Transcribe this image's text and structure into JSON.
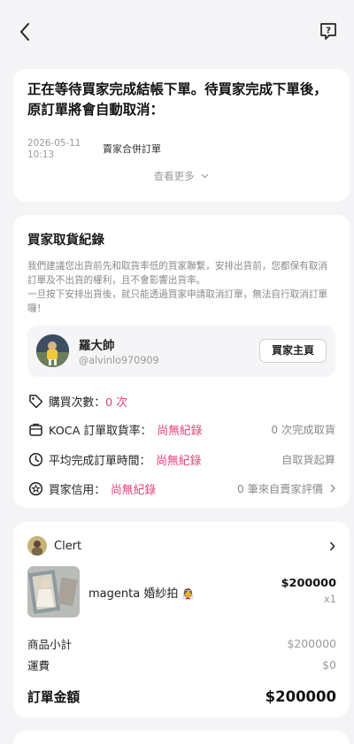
{
  "notice": {
    "text": "正在等待買家完成結帳下單。待買家完成下單後，原訂單將會自動取消："
  },
  "event": {
    "date": "2026-05-11",
    "time": "10:13",
    "label": "賣家合併訂單"
  },
  "see_more": "查看更多",
  "buyer_section": {
    "title": "買家取貨紀錄",
    "advice": "我們建議您出貨前先和取貨率低的買家聯繫，安排出貨前，您都保有取消訂單及不出貨的權利，且不會影響出貨率。\n一旦按下安排出貨後，就只能透過買家申請取消訂單，無法自行取消訂單囉！",
    "buyer_name": "羅大帥",
    "buyer_handle": "@alvinlo970909",
    "home_button": "買家主頁",
    "stats": {
      "purchases_label": "購買次數：",
      "purchases_value": "0 次",
      "pickup_label": "KOCA 訂單取貨率：",
      "pickup_value": "尚無紀錄",
      "pickup_right": "0 次完成取貨",
      "time_label": "平均完成訂單時間：",
      "time_value": "尚無紀錄",
      "time_right": "自取貨起算",
      "credit_label": "買家信用：",
      "credit_value": "尚無紀錄",
      "credit_right": "0 筆來自賣家評價"
    }
  },
  "order": {
    "shop_name": "Clert",
    "product_name": "magenta 婚紗拍",
    "product_emoji": "👰",
    "price": "$200000",
    "qty": "x1",
    "subtotal_label": "商品小計",
    "subtotal_value": "$200000",
    "shipping_label": "運費",
    "shipping_value": "$0",
    "total_label": "訂單金額",
    "total_value": "$200000"
  },
  "colors": {
    "accent": "#e8427a",
    "muted": "#9a9a9a",
    "background": "#f4f4f6"
  },
  "icons": [
    "back-arrow-icon",
    "help-question-icon",
    "chevron-down-icon",
    "tag-icon",
    "bag-icon",
    "clock-icon",
    "star-badge-icon",
    "chevron-right-icon"
  ]
}
